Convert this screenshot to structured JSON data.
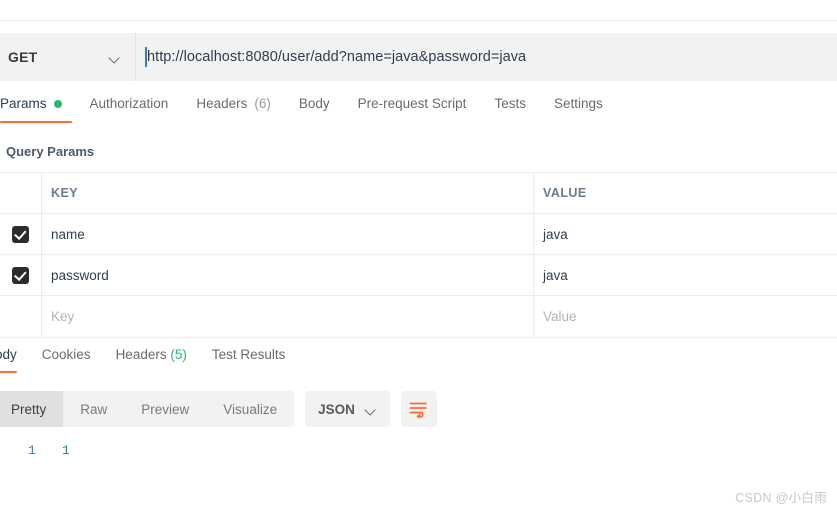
{
  "request": {
    "method": "GET",
    "method_chevron_icon": "chevron-down-icon",
    "url": "http://localhost:8080/user/add?name=java&password=java",
    "tabs": [
      {
        "label": "Params",
        "badge_icon": "green-dot-icon",
        "active": true
      },
      {
        "label": "Authorization",
        "active": false
      },
      {
        "label": "Headers",
        "count": "(6)",
        "active": false
      },
      {
        "label": "Body",
        "active": false
      },
      {
        "label": "Pre-request Script",
        "active": false
      },
      {
        "label": "Tests",
        "active": false
      },
      {
        "label": "Settings",
        "active": false
      }
    ]
  },
  "query_params": {
    "section_title": "Query Params",
    "columns": {
      "key": "KEY",
      "value": "VALUE"
    },
    "rows": [
      {
        "checked": true,
        "key": "name",
        "value": "java"
      },
      {
        "checked": true,
        "key": "password",
        "value": "java"
      }
    ],
    "empty_row": {
      "key_placeholder": "Key",
      "value_placeholder": "Value"
    }
  },
  "response": {
    "tabs": [
      {
        "label": "Body",
        "active": true
      },
      {
        "label": "Cookies",
        "active": false
      },
      {
        "label": "Headers",
        "count": "(5)",
        "active": false
      },
      {
        "label": "Test Results",
        "active": false
      }
    ],
    "format_tabs": [
      {
        "label": "Pretty",
        "active": true
      },
      {
        "label": "Raw",
        "active": false
      },
      {
        "label": "Preview",
        "active": false
      },
      {
        "label": "Visualize",
        "active": false
      }
    ],
    "content_type": "JSON",
    "content_type_chevron_icon": "chevron-down-icon",
    "wrap_icon": "word-wrap-icon",
    "body": {
      "line_number": "1",
      "value": "1"
    }
  },
  "watermark": "CSDN @小白雨",
  "colors": {
    "accent": "#ff6c37",
    "success": "#2ab673",
    "toolbar_bg": "#f2f2f2",
    "text_primary": "#2f3e4e",
    "text_muted": "#6b6b6b"
  }
}
